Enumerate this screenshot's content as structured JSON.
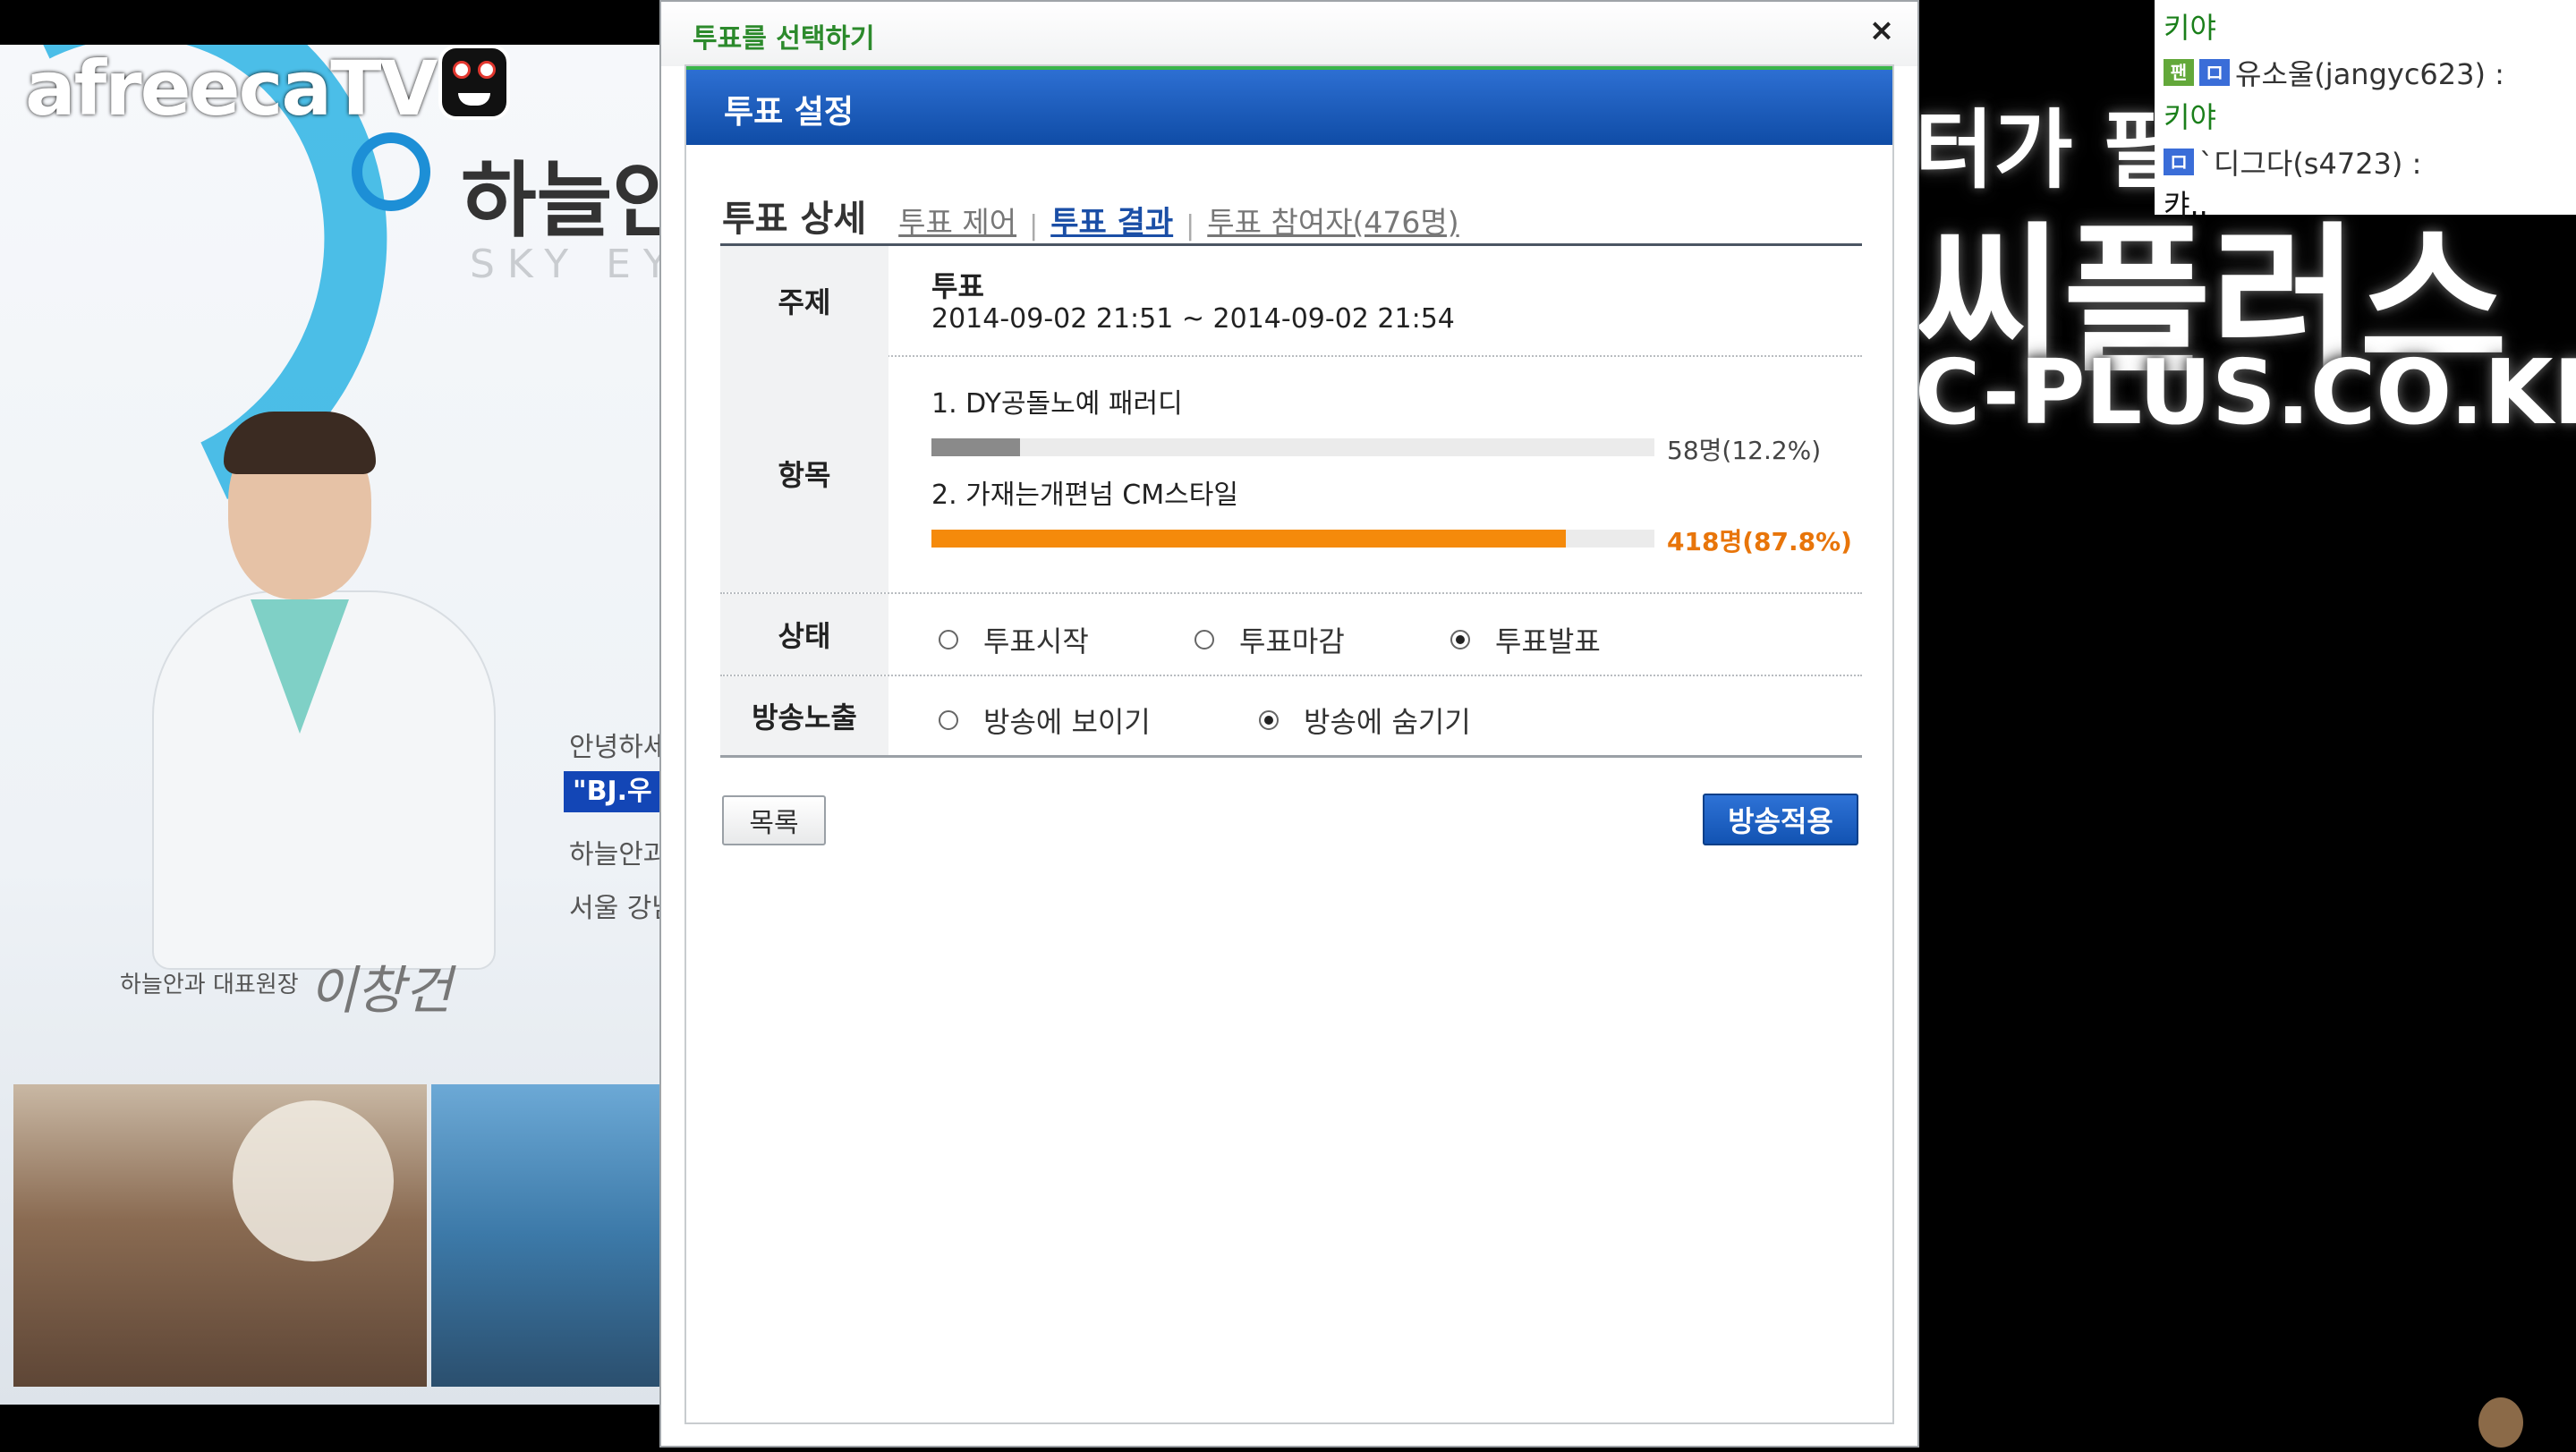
{
  "stream": {
    "brand_logo": "afreecaTV",
    "ad": {
      "logo_text": "하늘안",
      "logo_sub": "SKY EYE",
      "side_texts": [
        "안녕하세",
        "하늘안과",
        "서울 강남"
      ],
      "bj_tag": "\"BJ.우",
      "caption": "하늘안과 대표원장",
      "signature": "이창건"
    },
    "promo": {
      "line1": "터가 필",
      "line2": "씨플러스",
      "line3": "C-PLUS.CO.KR"
    },
    "chat": [
      {
        "type": "msg",
        "text": "키야"
      },
      {
        "type": "user",
        "badges": [
          "팬",
          "ロ"
        ],
        "text": "유소울(jangyc623) :"
      },
      {
        "type": "msg",
        "text": "키야"
      },
      {
        "type": "user",
        "badges": [
          "ロ"
        ],
        "text": "`디그다(s4723) :"
      },
      {
        "type": "plain",
        "text": "캬.."
      }
    ]
  },
  "dialog": {
    "title": "투표를 선택하기",
    "close_label": "×",
    "section_title": "투표 설정",
    "tabs": {
      "current": "투표 상세",
      "control": "투표 제어",
      "result": "투표 결과",
      "participants": "투표 참여자(476명)",
      "separator": "|"
    },
    "subject": {
      "label": "주제",
      "title": "투표",
      "period": "2014-09-02 21:51 ~ 2014-09-02 21:54"
    },
    "items": {
      "label": "항목",
      "options": [
        {
          "text": "1. DY공돌노예 패러디",
          "count": "58명(12.2%)",
          "percent": 12.2,
          "color": "#8a8a8a",
          "count_color": "#444444"
        },
        {
          "text": "2. 가재는개편넘 CM스타일",
          "count": "418명(87.8%)",
          "percent": 87.8,
          "color": "#f58a0b",
          "count_color": "#e8750a"
        }
      ]
    },
    "status": {
      "label": "상태",
      "options": [
        {
          "text": "투표시작",
          "checked": false
        },
        {
          "text": "투표마감",
          "checked": false
        },
        {
          "text": "투표발표",
          "checked": true
        }
      ]
    },
    "broadcast": {
      "label": "방송노출",
      "options": [
        {
          "text": "방송에 보이기",
          "checked": false
        },
        {
          "text": "방송에 숨기기",
          "checked": true
        }
      ]
    },
    "list_button": "목록",
    "apply_button": "방송적용"
  }
}
